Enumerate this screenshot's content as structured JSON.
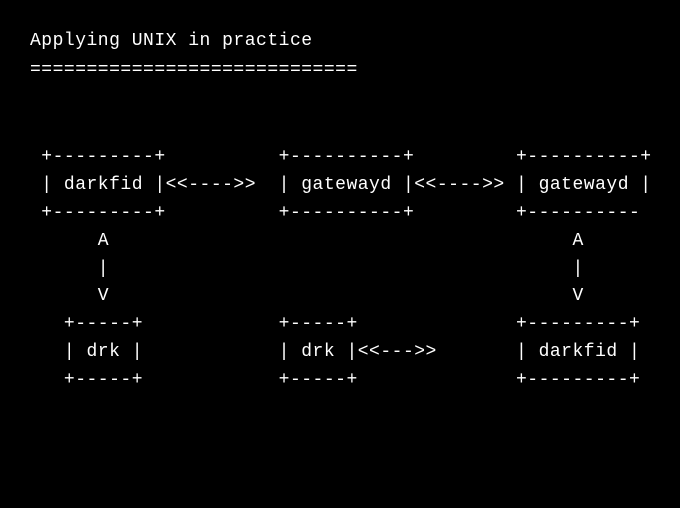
{
  "title": "Applying UNIX in practice",
  "underline": "=============================",
  "diagram_lines": [
    " +---------+          +----------+         +----------+",
    " | darkfid |<<---->>  | gatewayd |<<---->> | gatewayd |",
    " +---------+          +----------+         +---------- ",
    "      A                                         A",
    "      |                                         |",
    "      V                                         V",
    "   +-----+            +-----+              +---------+",
    "   | drk |            | drk |<<--->>       | darkfid |",
    "   +-----+            +-----+              +---------+"
  ],
  "diagram_nodes": {
    "top_row": [
      "darkfid",
      "gatewayd",
      "gatewayd"
    ],
    "bottom_row": [
      "drk",
      "drk",
      "darkfid"
    ],
    "connectors": {
      "horizontal": "<<---->>",
      "vertical": [
        "A",
        "|",
        "V"
      ]
    }
  }
}
